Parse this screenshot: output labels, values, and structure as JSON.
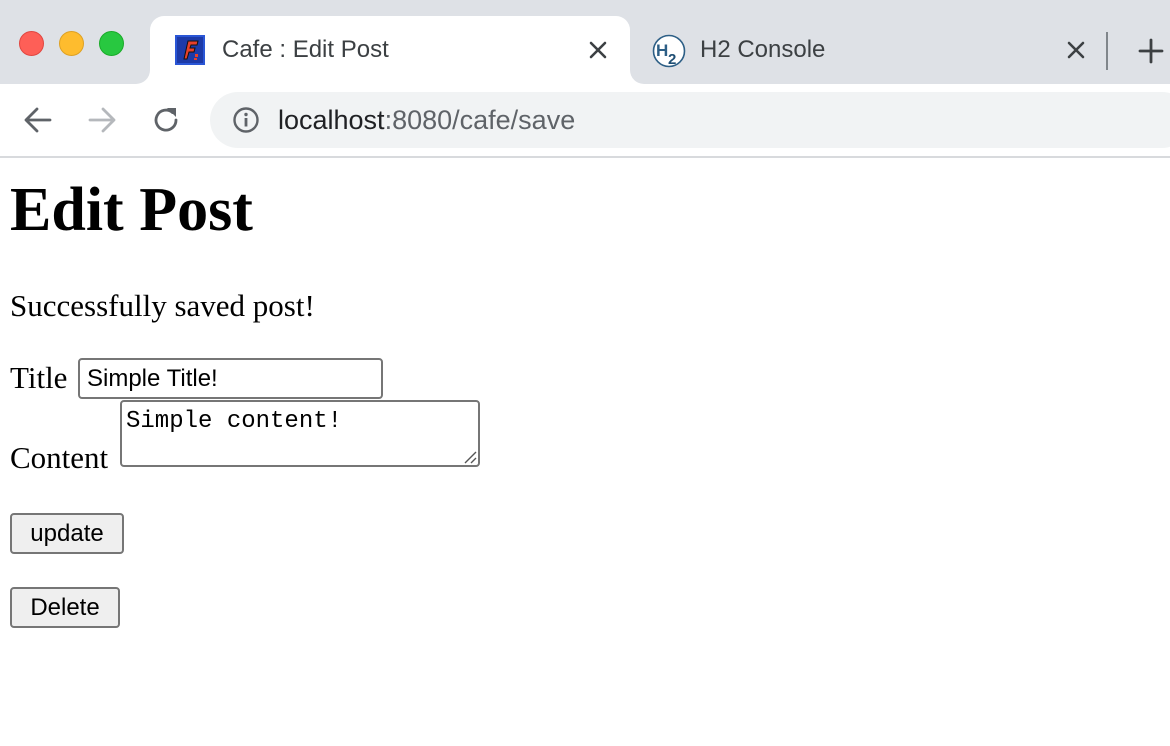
{
  "window": {
    "traffic_lights": [
      "close",
      "minimize",
      "zoom"
    ],
    "colors": {
      "red": "#fe5f57",
      "yellow": "#febc2e",
      "green": "#28c840"
    }
  },
  "tabs": [
    {
      "title": "Cafe : Edit Post",
      "favicon": "cafe-favicon-icon",
      "active": true
    },
    {
      "title": "H2 Console",
      "favicon": "h2-favicon-icon",
      "active": false
    }
  ],
  "toolbar": {
    "url_host": "localhost",
    "url_rest": ":8080/cafe/save"
  },
  "page": {
    "heading": "Edit Post",
    "status_message": "Successfully saved post!",
    "form": {
      "title_label": "Title",
      "title_value": "Simple Title!",
      "content_label": "Content",
      "content_value": "Simple content!",
      "update_label": "update",
      "delete_label": "Delete"
    }
  }
}
